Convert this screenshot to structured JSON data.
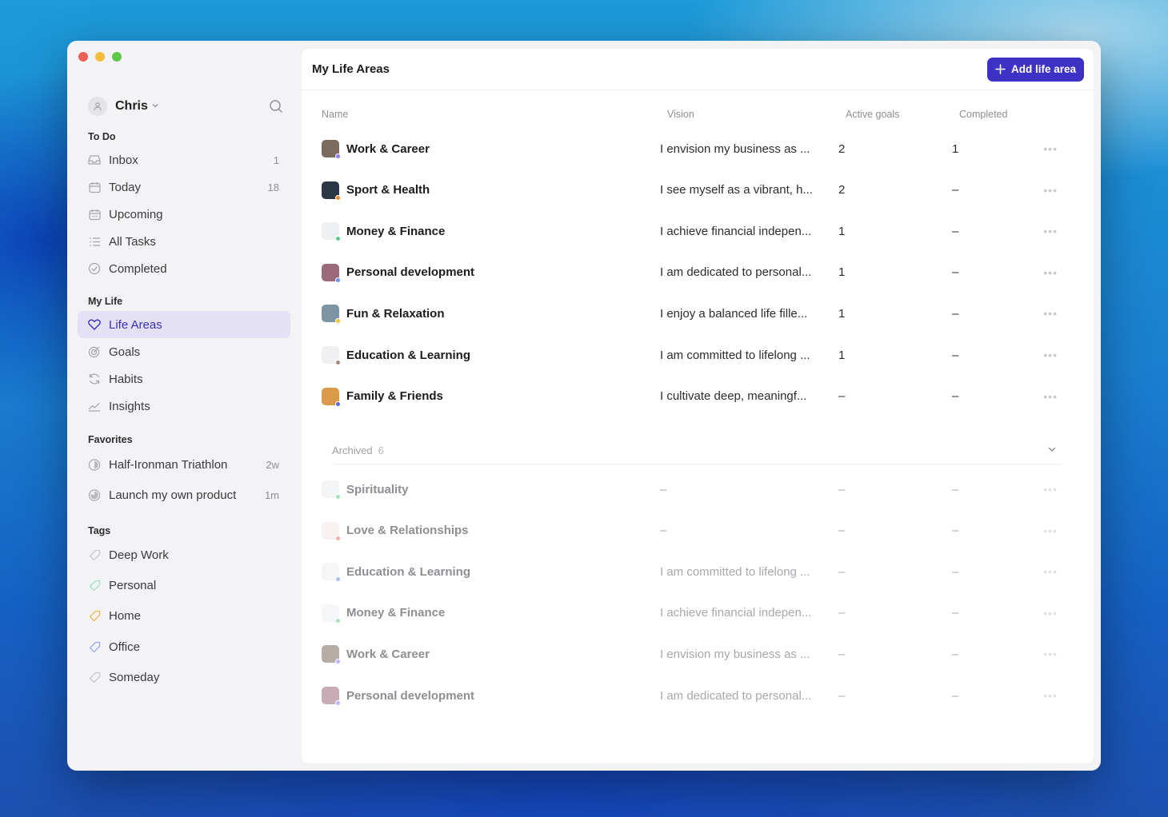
{
  "user": {
    "name": "Chris"
  },
  "sidebar": {
    "todo": {
      "title": "To Do",
      "items": [
        {
          "label": "Inbox",
          "count": "1",
          "icon": "inbox-icon"
        },
        {
          "label": "Today",
          "count": "18",
          "icon": "calendar-icon"
        },
        {
          "label": "Upcoming",
          "count": "",
          "icon": "calendar-grid-icon"
        },
        {
          "label": "All Tasks",
          "count": "",
          "icon": "list-icon"
        },
        {
          "label": "Completed",
          "count": "",
          "icon": "check-circle-icon"
        }
      ]
    },
    "mylife": {
      "title": "My Life",
      "items": [
        {
          "label": "Life Areas",
          "icon": "heart-icon",
          "active": true
        },
        {
          "label": "Goals",
          "icon": "target-icon"
        },
        {
          "label": "Habits",
          "icon": "refresh-icon"
        },
        {
          "label": "Insights",
          "icon": "chart-icon"
        }
      ]
    },
    "favorites": {
      "title": "Favorites",
      "items": [
        {
          "label": "Half-Ironman Triathlon",
          "meta": "2w"
        },
        {
          "label": "Launch my own product",
          "meta": "1m"
        }
      ]
    },
    "tags": {
      "title": "Tags",
      "items": [
        {
          "label": "Deep Work",
          "color": "#c7c7cc"
        },
        {
          "label": "Personal",
          "color": "#9fe0c0"
        },
        {
          "label": "Home",
          "color": "#f2b64a"
        },
        {
          "label": "Office",
          "color": "#9aa7f2"
        },
        {
          "label": "Someday",
          "color": "#c7c7cc"
        }
      ]
    }
  },
  "main": {
    "title": "My Life Areas",
    "add_label": "Add life area",
    "columns": {
      "name": "Name",
      "vision": "Vision",
      "goals": "Active goals",
      "completed": "Completed"
    },
    "areas": [
      {
        "name": "Work & Career",
        "vision": "I envision my business as ...",
        "goals": "2",
        "completed": "1",
        "thumb": "#7a6b5e",
        "dot": "#8b7cf2"
      },
      {
        "name": "Sport & Health",
        "vision": "I see myself as a vibrant, h...",
        "goals": "2",
        "completed": "–",
        "thumb": "#2b3646",
        "dot": "#f28a30"
      },
      {
        "name": "Money & Finance",
        "vision": "I achieve financial indepen...",
        "goals": "1",
        "completed": "–",
        "thumb": "#eef0f2",
        "dot": "#5dc98a"
      },
      {
        "name": "Personal development",
        "vision": "I am dedicated to personal...",
        "goals": "1",
        "completed": "–",
        "thumb": "#9a6a7a",
        "dot": "#6a8ef0"
      },
      {
        "name": "Fun & Relaxation",
        "vision": "I enjoy a balanced life fille...",
        "goals": "1",
        "completed": "–",
        "thumb": "#7d94a3",
        "dot": "#f2c23a"
      },
      {
        "name": "Education & Learning",
        "vision": "I am committed to lifelong ...",
        "goals": "1",
        "completed": "–",
        "thumb": "#f0f0f2",
        "dot": "#a08a7a"
      },
      {
        "name": "Family & Friends",
        "vision": "I cultivate deep, meaningf...",
        "goals": "–",
        "completed": "–",
        "thumb": "#d99a4a",
        "dot": "#5a6ad0"
      }
    ],
    "archived": {
      "label": "Archived",
      "count": "6",
      "items": [
        {
          "name": "Spirituality",
          "vision": "–",
          "goals": "–",
          "completed": "–",
          "thumb": "#eceef0",
          "dot": "#5dc98a"
        },
        {
          "name": "Love & Relationships",
          "vision": "–",
          "goals": "–",
          "completed": "–",
          "thumb": "#f4e6e6",
          "dot": "#f07060"
        },
        {
          "name": "Education & Learning",
          "vision": "I am committed to lifelong ...",
          "goals": "–",
          "completed": "–",
          "thumb": "#f0f0f2",
          "dot": "#6a8ef0"
        },
        {
          "name": "Money & Finance",
          "vision": "I achieve financial indepen...",
          "goals": "–",
          "completed": "–",
          "thumb": "#eef0f2",
          "dot": "#5dc98a"
        },
        {
          "name": "Work & Career",
          "vision": "I envision my business as ...",
          "goals": "–",
          "completed": "–",
          "thumb": "#7a6b5e",
          "dot": "#8b7cf2"
        },
        {
          "name": "Personal development",
          "vision": "I am dedicated to personal...",
          "goals": "–",
          "completed": "–",
          "thumb": "#9a6a7a",
          "dot": "#8b7cf2"
        }
      ]
    }
  }
}
